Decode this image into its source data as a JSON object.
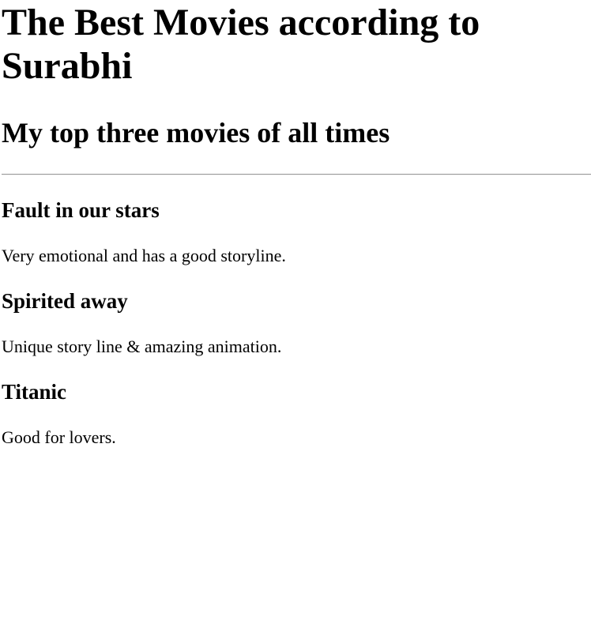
{
  "page": {
    "title": "The Best Movies according to Surabhi",
    "subtitle": "My top three movies of all times"
  },
  "movies": [
    {
      "title": "Fault in our stars",
      "description": "Very emotional and has a good storyline."
    },
    {
      "title": "Spirited away",
      "description": "Unique story line & amazing animation."
    },
    {
      "title": "Titanic",
      "description": "Good for lovers."
    }
  ]
}
